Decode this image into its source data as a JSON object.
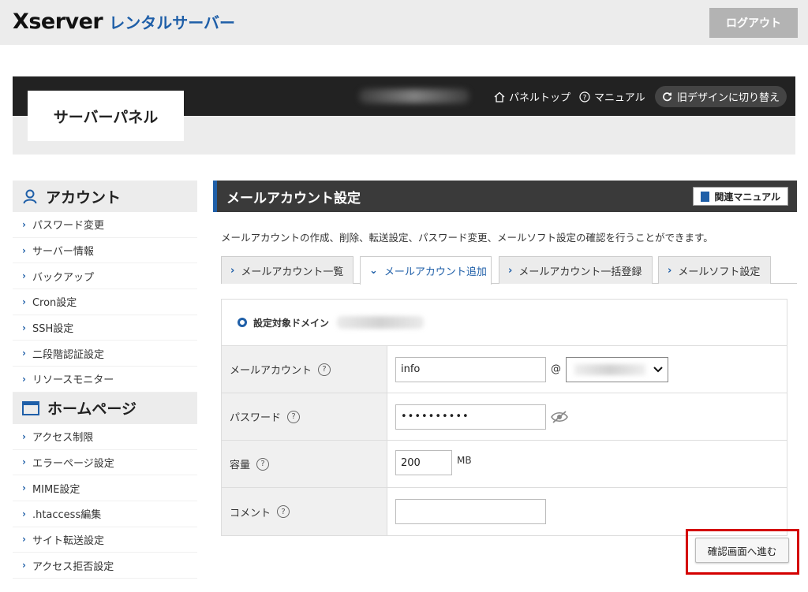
{
  "header": {
    "logo_main": "Xserver",
    "logo_sub": "レンタルサーバー",
    "logout_label": "ログアウト"
  },
  "panel": {
    "title": "サーバーパネル",
    "nav": {
      "panel_top": "パネルトップ",
      "manual": "マニュアル",
      "old_design": "旧デザインに切り替え"
    }
  },
  "sidebar": {
    "account_heading": "アカウント",
    "account_items": [
      "パスワード変更",
      "サーバー情報",
      "バックアップ",
      "Cron設定",
      "SSH設定",
      "二段階認証設定",
      "リソースモニター"
    ],
    "homepage_heading": "ホームページ",
    "homepage_items": [
      "アクセス制限",
      "エラーページ設定",
      "MIME設定",
      ".htaccess編集",
      "サイト転送設定",
      "アクセス拒否設定"
    ]
  },
  "main": {
    "title": "メールアカウント設定",
    "manual_button": "関連マニュアル",
    "description": "メールアカウントの作成、削除、転送設定、パスワード変更、メールソフト設定の確認を行うことができます。",
    "tabs": [
      "メールアカウント一覧",
      "メールアカウント追加",
      "メールアカウント一括登録",
      "メールソフト設定"
    ],
    "active_tab": "メールアカウント追加"
  },
  "form": {
    "domain_label": "設定対象ドメイン",
    "account_label": "メールアカウント",
    "account_value": "info",
    "at_sign": "@",
    "password_label": "パスワード",
    "password_value": "••••••••••",
    "capacity_label": "容量",
    "capacity_value": "200",
    "capacity_unit": "MB",
    "comment_label": "コメント",
    "comment_value": "",
    "help_glyph": "?",
    "next_button": "確認画面へ進む"
  },
  "colors": {
    "accent": "#1f5fa8",
    "dark_bar": "#222222",
    "highlight": "#d40000"
  }
}
